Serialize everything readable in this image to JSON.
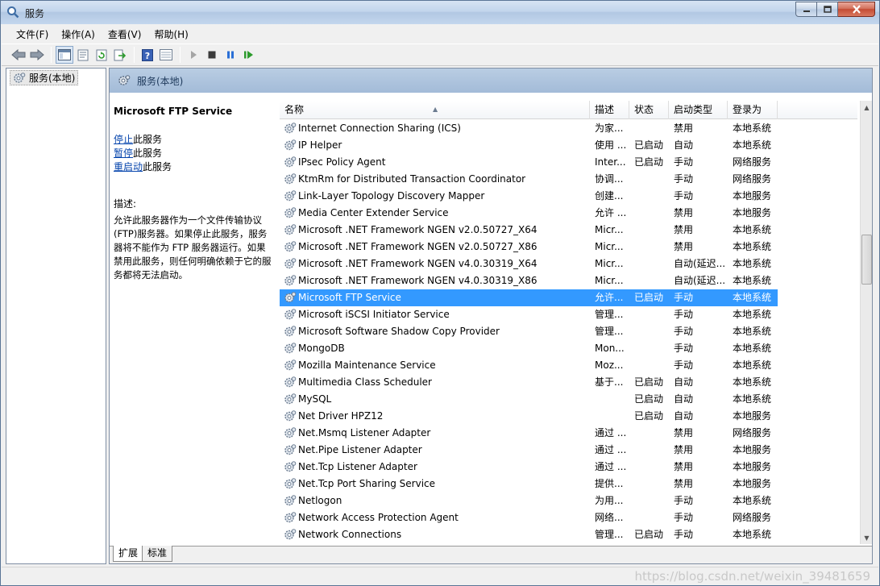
{
  "window": {
    "title": "服务"
  },
  "menu": [
    "文件(F)",
    "操作(A)",
    "查看(V)",
    "帮助(H)"
  ],
  "toolbar": {
    "buttons": [
      "back-icon",
      "forward-icon",
      "console-tree-icon",
      "properties-icon",
      "refresh-icon",
      "export-list-icon",
      "help-icon",
      "details-view-icon",
      "start-icon",
      "stop-icon",
      "pause-icon",
      "restart-icon"
    ]
  },
  "tree": {
    "node": "服务(本地)"
  },
  "panel": {
    "header": "服务(本地)"
  },
  "detail": {
    "service_name": "Microsoft FTP Service",
    "actions": [
      {
        "link": "停止",
        "rest": "此服务"
      },
      {
        "link": "暂停",
        "rest": "此服务"
      },
      {
        "link": "重启动",
        "rest": "此服务"
      }
    ],
    "description_label": "描述:",
    "description": "允许此服务器作为一个文件传输协议(FTP)服务器。如果停止此服务，服务器将不能作为 FTP 服务器运行。如果禁用此服务，则任何明确依赖于它的服务都将无法启动。"
  },
  "columns": [
    "名称",
    "描述",
    "状态",
    "启动类型",
    "登录为"
  ],
  "rows": [
    [
      "Internet Connection Sharing (ICS)",
      "为家...",
      "",
      "禁用",
      "本地系统"
    ],
    [
      "IP Helper",
      "使用 ...",
      "已启动",
      "自动",
      "本地系统"
    ],
    [
      "IPsec Policy Agent",
      "Inter...",
      "已启动",
      "手动",
      "网络服务"
    ],
    [
      "KtmRm for Distributed Transaction Coordinator",
      "协调...",
      "",
      "手动",
      "网络服务"
    ],
    [
      "Link-Layer Topology Discovery Mapper",
      "创建...",
      "",
      "手动",
      "本地服务"
    ],
    [
      "Media Center Extender Service",
      "允许 ...",
      "",
      "禁用",
      "本地服务"
    ],
    [
      "Microsoft .NET Framework NGEN v2.0.50727_X64",
      "Micr...",
      "",
      "禁用",
      "本地系统"
    ],
    [
      "Microsoft .NET Framework NGEN v2.0.50727_X86",
      "Micr...",
      "",
      "禁用",
      "本地系统"
    ],
    [
      "Microsoft .NET Framework NGEN v4.0.30319_X64",
      "Micr...",
      "",
      "自动(延迟...",
      "本地系统"
    ],
    [
      "Microsoft .NET Framework NGEN v4.0.30319_X86",
      "Micr...",
      "",
      "自动(延迟...",
      "本地系统"
    ],
    [
      "Microsoft FTP Service",
      "允许...",
      "已启动",
      "手动",
      "本地系统"
    ],
    [
      "Microsoft iSCSI Initiator Service",
      "管理...",
      "",
      "手动",
      "本地系统"
    ],
    [
      "Microsoft Software Shadow Copy Provider",
      "管理...",
      "",
      "手动",
      "本地系统"
    ],
    [
      "MongoDB",
      "Mon...",
      "",
      "手动",
      "本地系统"
    ],
    [
      "Mozilla Maintenance Service",
      "Moz...",
      "",
      "手动",
      "本地系统"
    ],
    [
      "Multimedia Class Scheduler",
      "基于...",
      "已启动",
      "自动",
      "本地系统"
    ],
    [
      "MySQL",
      "",
      "已启动",
      "自动",
      "本地系统"
    ],
    [
      "Net Driver HPZ12",
      "",
      "已启动",
      "自动",
      "本地服务"
    ],
    [
      "Net.Msmq Listener Adapter",
      "通过 ...",
      "",
      "禁用",
      "网络服务"
    ],
    [
      "Net.Pipe Listener Adapter",
      "通过 ...",
      "",
      "禁用",
      "本地服务"
    ],
    [
      "Net.Tcp Listener Adapter",
      "通过 ...",
      "",
      "禁用",
      "本地服务"
    ],
    [
      "Net.Tcp Port Sharing Service",
      "提供...",
      "",
      "禁用",
      "本地服务"
    ],
    [
      "Netlogon",
      "为用...",
      "",
      "手动",
      "本地系统"
    ],
    [
      "Network Access Protection Agent",
      "网络...",
      "",
      "手动",
      "网络服务"
    ],
    [
      "Network Connections",
      "管理...",
      "已启动",
      "手动",
      "本地系统"
    ]
  ],
  "selected_row": 10,
  "tabs": [
    "扩展",
    "标准"
  ],
  "watermark": "https://blog.csdn.net/weixin_39481659"
}
